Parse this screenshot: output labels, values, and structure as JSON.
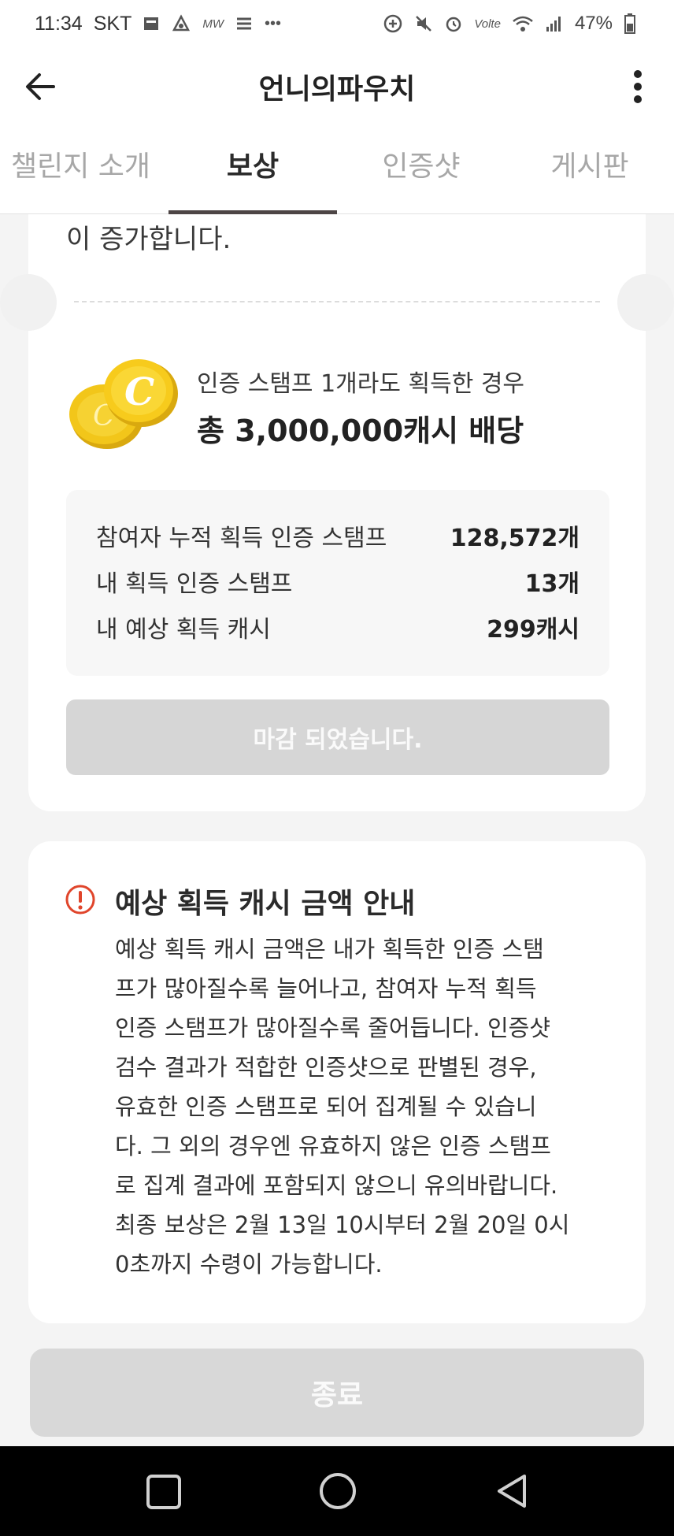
{
  "status_bar": {
    "time": "11:34",
    "carrier": "SKT",
    "left_icons": [
      "sim-icon",
      "alert-bell-icon",
      "mw-icon",
      "stack-icon",
      "more-dots-icon"
    ],
    "right_icons": [
      "sync-icon",
      "mute-icon",
      "alarm-icon",
      "volte-icon",
      "wifi-icon",
      "signal-icon"
    ],
    "volte_label": "Volte",
    "mw_label": "MW",
    "battery": "47%"
  },
  "app_bar": {
    "title": "언니의파우치",
    "back_icon": "back-arrow-icon",
    "more_icon": "more-vertical-icon"
  },
  "tabs": [
    {
      "label": "챌린지 소개",
      "active": false
    },
    {
      "label": "보상",
      "active": true
    },
    {
      "label": "인증샷",
      "active": false
    },
    {
      "label": "게시판",
      "active": false
    }
  ],
  "reward_card": {
    "top_text": "이 증가합니다.",
    "coin_icon": "coin-icon",
    "subtitle": "인증 스탬프 1개라도 획득한 경우",
    "title": "총 3,000,000캐시 배당",
    "stats": [
      {
        "label": "참여자 누적 획득 인증 스탬프",
        "value": "128,572개"
      },
      {
        "label": "내 획득 인증 스탬프",
        "value": "13개"
      },
      {
        "label": "내 예상 획득 캐시",
        "value": "299캐시"
      }
    ],
    "closed_button": "마감 되었습니다."
  },
  "notice": {
    "icon": "alert-circle-icon",
    "title": "예상 획득 캐시 금액 안내",
    "lines": [
      "예상 획득 캐시 금액은 내가 획득한 인증 스탬",
      "프가 많아질수록 늘어나고, 참여자 누적 획득",
      "인증 스탬프가 많아질수록 줄어듭니다. 인증샷",
      "검수 결과가 적합한 인증샷으로 판별된 경우,",
      "유효한 인증 스탬프로 되어 집계될 수 있습니",
      "다. 그 외의 경우엔 유효하지 않은 인증 스탬프",
      "로 집계 결과에 포함되지 않으니 유의바랍니다.",
      "최종 보상은 2월 13일 10시부터 2월 20일 0시",
      "0초까지 수령이 가능합니다."
    ]
  },
  "end_button": {
    "label": "종료"
  },
  "nav_bar": {
    "icons": [
      "recent-apps-icon",
      "home-icon",
      "back-icon"
    ]
  },
  "colors": {
    "accent_alert": "#e0452b",
    "coin_gold": "#f2c61a",
    "tab_indicator": "#4d4545",
    "disabled_button": "#d6d6d6"
  }
}
